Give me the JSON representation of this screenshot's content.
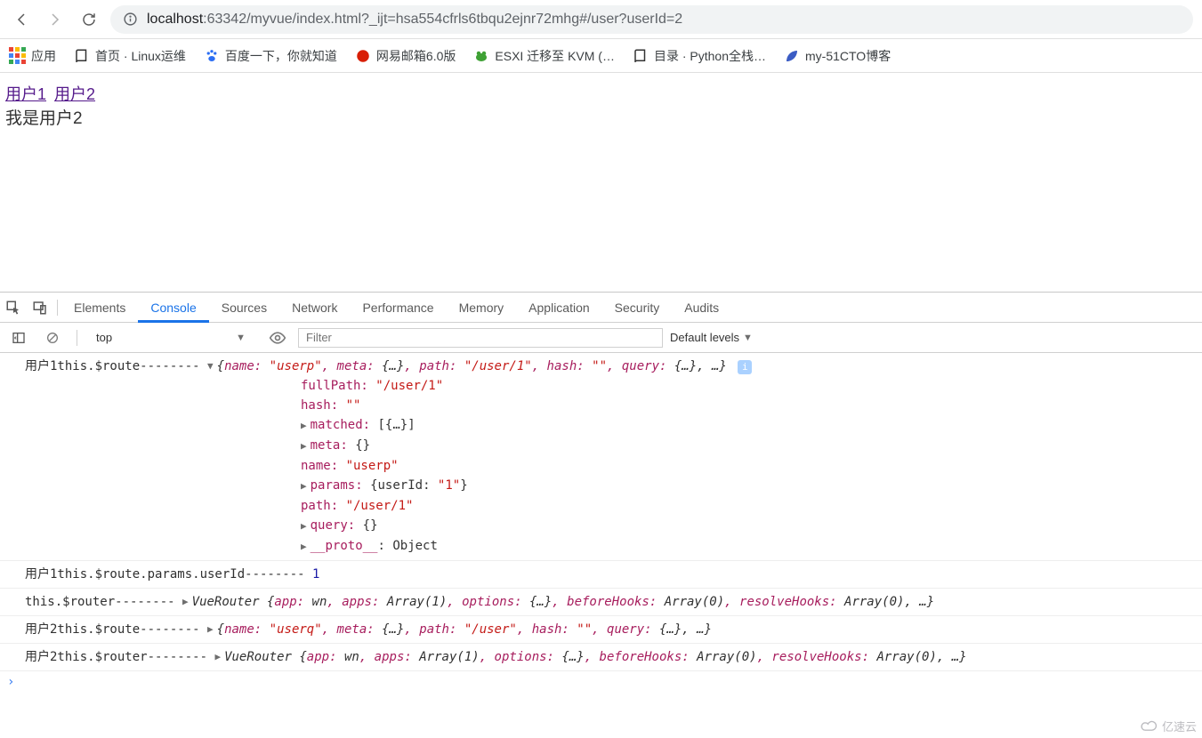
{
  "url": "localhost:63342/myvue/index.html?_ijt=hsa554cfrls6tbqu2ejnr72mhg#/user?userId=2",
  "url_host": "localhost",
  "url_path": ":63342/myvue/index.html?_ijt=hsa554cfrls6tbqu2ejnr72mhg#/user?userId=2",
  "bookmarks": {
    "apps": "应用",
    "b1": "首页 · Linux运维",
    "b2": "百度一下，你就知道",
    "b3": "网易邮箱6.0版",
    "b4": "ESXI 迁移至 KVM (…",
    "b5": "目录 · Python全栈…",
    "b6": "my-51CTO博客"
  },
  "page": {
    "link1": "用户1",
    "link2": "用户2",
    "text": "我是用户2"
  },
  "devtools": {
    "tabs": {
      "elements": "Elements",
      "console": "Console",
      "sources": "Sources",
      "network": "Network",
      "performance": "Performance",
      "memory": "Memory",
      "application": "Application",
      "security": "Security",
      "audits": "Audits"
    },
    "context": "top",
    "filter_placeholder": "Filter",
    "levels": "Default levels"
  },
  "log1": {
    "label": "用户1this.$route-------- ",
    "summary_open": "{",
    "k_name": "name: ",
    "v_name": "\"userp\"",
    "k_meta": ", meta: ",
    "v_meta": "{…}",
    "k_path": ", path: ",
    "v_path": "\"/user/1\"",
    "k_hash": ", hash: ",
    "v_hash": "\"\"",
    "k_query": ", query: ",
    "v_query": "{…}, …}",
    "p_fullPath_k": "fullPath: ",
    "p_fullPath_v": "\"/user/1\"",
    "p_hash_k": "hash: ",
    "p_hash_v": "\"\"",
    "p_matched_k": "matched: ",
    "p_matched_v": "[{…}]",
    "p_meta_k": "meta: ",
    "p_meta_v": "{}",
    "p_name_k": "name: ",
    "p_name_v": "\"userp\"",
    "p_params_k": "params: ",
    "p_params_v": "{userId: ",
    "p_params_v2": "\"1\"",
    "p_params_v3": "}",
    "p_path_k": "path: ",
    "p_path_v": "\"/user/1\"",
    "p_query_k": "query: ",
    "p_query_v": "{}",
    "p_proto_k": "__proto__",
    "p_proto_v": ": Object"
  },
  "log2": {
    "label": "用户1this.$route.params.userId-------- ",
    "val": "1"
  },
  "log3": {
    "label": "this.$router-------- ",
    "cls": "VueRouter ",
    "body": "{",
    "k_app": "app: ",
    "v_app": "wn",
    "k_apps": ", apps: ",
    "v_apps": "Array(1)",
    "k_opt": ", options: ",
    "v_opt": "{…}",
    "k_bh": ", beforeHooks: ",
    "v_bh": "Array(0)",
    "k_rh": ", resolveHooks: ",
    "v_rh": "Array(0), …}"
  },
  "log4": {
    "label": "用户2this.$route-------- ",
    "body_open": "{",
    "k_name": "name: ",
    "v_name": "\"userq\"",
    "k_meta": ", meta: ",
    "v_meta": "{…}",
    "k_path": ", path: ",
    "v_path": "\"/user\"",
    "k_hash": ", hash: ",
    "v_hash": "\"\"",
    "k_query": ", query: ",
    "v_query": "{…}, …}"
  },
  "log5": {
    "label": "用户2this.$router-------- ",
    "cls": "VueRouter ",
    "body": "{",
    "k_app": "app: ",
    "v_app": "wn",
    "k_apps": ", apps: ",
    "v_apps": "Array(1)",
    "k_opt": ", options: ",
    "v_opt": "{…}",
    "k_bh": ", beforeHooks: ",
    "v_bh": "Array(0)",
    "k_rh": ", resolveHooks: ",
    "v_rh": "Array(0), …}"
  },
  "watermark": "亿速云"
}
